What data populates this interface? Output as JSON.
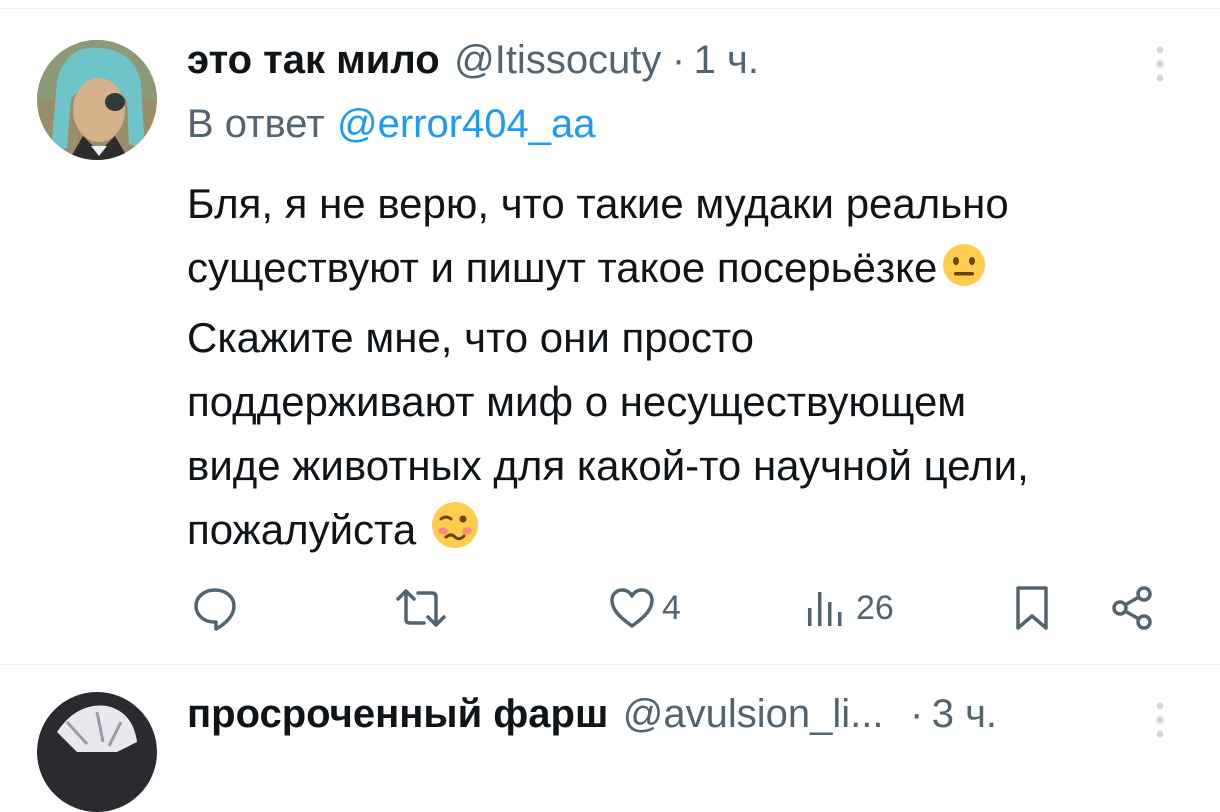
{
  "top_divider": true,
  "tweet": {
    "display_name": "это так мило",
    "handle": "@Itissocuty",
    "separator": "·",
    "time": "1 ч.",
    "reply_prefix": "В ответ",
    "reply_to": "@error404_aa",
    "text_lines": [
      "Бля, я не верю, что такие мудаки реально",
      "существуют и пишут такое посерьёзке",
      "Скажите мне, что они просто",
      "поддерживают миф о несуществующем",
      "виде животных для какой-то научной цели,",
      "пожалуйста"
    ],
    "emojis": [
      "neutral-face-emoji",
      "woozy-face-emoji"
    ],
    "likes": "4",
    "views": "26",
    "icons": [
      "more-icon",
      "reply-icon",
      "retweet-icon",
      "like-icon",
      "views-icon",
      "bookmark-icon",
      "share-icon"
    ]
  },
  "next_tweet": {
    "display_name": "просроченный фарш",
    "handle": "@avulsion_li...",
    "separator": "·",
    "time": "3 ч."
  },
  "colors": {
    "text": "#0f1419",
    "muted": "#536471",
    "link": "#1d9bf0",
    "divider": "#eff3f4",
    "emoji": "#ffcc4d"
  }
}
